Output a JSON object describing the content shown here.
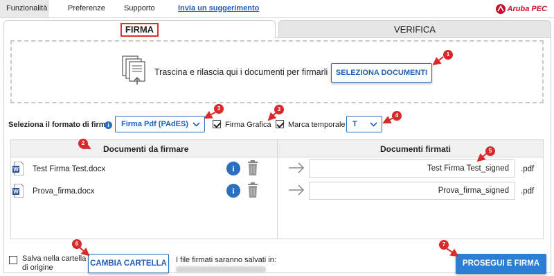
{
  "menu": {
    "items": [
      "Funzionalità",
      "Preferenze",
      "Supporto"
    ],
    "suggest_link": "Invia un suggerimento",
    "brand": "Aruba PEC"
  },
  "tabs": {
    "firma": "FIRMA",
    "verifica": "VERIFICA"
  },
  "dropzone": {
    "text": "Trascina e rilascia qui i documenti per firmarli",
    "button": "SELEZIONA DOCUMENTI"
  },
  "format": {
    "label": "Seleziona il formato di firma",
    "info_glyph": "i",
    "selected": "Firma Pdf (PAdES)",
    "firma_grafica": {
      "label": "Firma Grafica",
      "checked": true
    },
    "marca_temporale": {
      "label": "Marca temporale",
      "checked": true
    },
    "timestamp_selected": "T"
  },
  "table": {
    "headers": [
      "Documenti da firmare",
      "Documenti firmati"
    ],
    "rows": [
      {
        "input": "Test Firma Test.docx",
        "output": "Test Firma Test_signed",
        "ext": ".pdf"
      },
      {
        "input": "Prova_firma.docx",
        "output": "Prova_firma_signed",
        "ext": ".pdf"
      }
    ]
  },
  "footer": {
    "save_origin": "Salva nella cartella di origine",
    "save_origin_line1": "Salva nella cartella",
    "save_origin_line2": "di origine",
    "change_folder": "CAMBIA CARTELLA",
    "save_note": "I file firmati saranno salvati in:",
    "proceed": "PROSEGUI E FIRMA"
  },
  "annotations": {
    "badges": [
      "1",
      "2",
      "3",
      "3",
      "4",
      "5",
      "6",
      "7"
    ]
  },
  "colors": {
    "accent": "#2a7fd4",
    "link": "#1f5fb8",
    "annotation_red": "#d82a2a",
    "brand_red": "#c8102e"
  }
}
